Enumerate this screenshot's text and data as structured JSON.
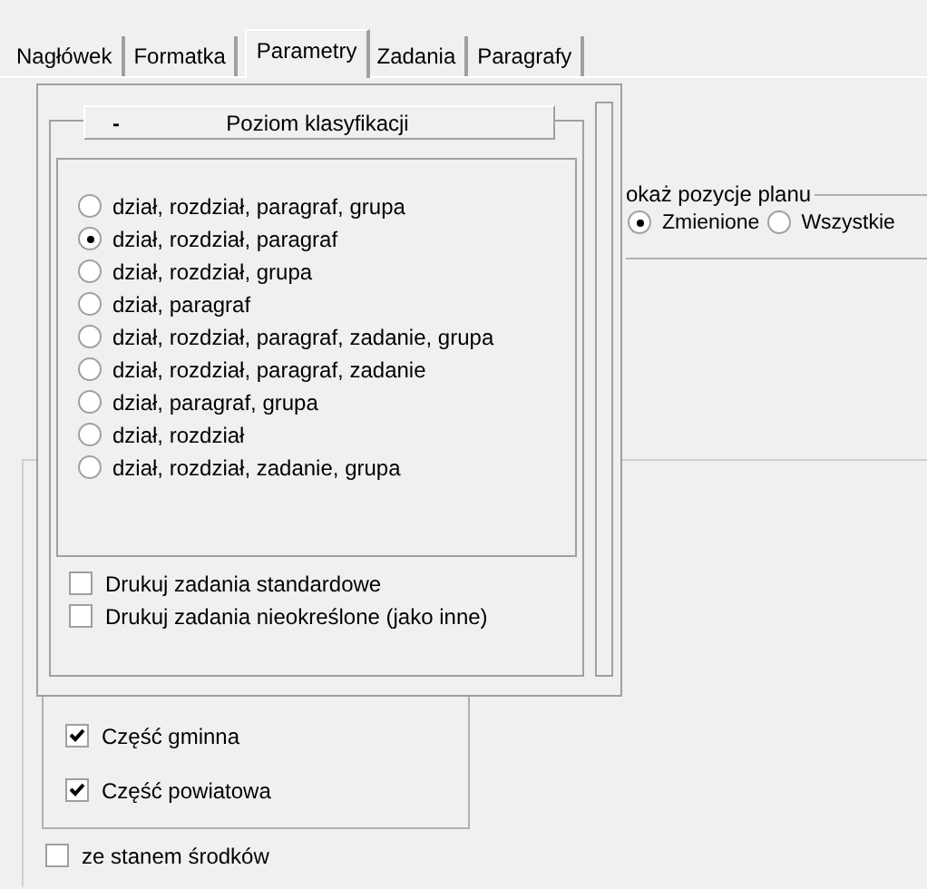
{
  "tabs": [
    {
      "label": "Nagłówek",
      "selected": false
    },
    {
      "label": "Formatka",
      "selected": false
    },
    {
      "label": "Parametry",
      "selected": true
    },
    {
      "label": "Zadania",
      "selected": false
    },
    {
      "label": "Paragrafy",
      "selected": false
    }
  ],
  "plan_group": {
    "title": "okaż pozycje planu",
    "options": [
      {
        "label": "Zmienione",
        "selected": true
      },
      {
        "label": "Wszystkie",
        "selected": false
      }
    ]
  },
  "parts_group": {
    "options": [
      {
        "label": "Część gminna",
        "checked": true
      },
      {
        "label": "Część powiatowa",
        "checked": true
      }
    ]
  },
  "balance_checkbox": {
    "label": "ze stanem środków",
    "checked": false
  },
  "popup": {
    "toggle": "-",
    "title": "Poziom klasyfikacji",
    "levels": [
      {
        "label": "dział, rozdział, paragraf, grupa",
        "selected": false
      },
      {
        "label": "dział, rozdział, paragraf",
        "selected": true
      },
      {
        "label": "dział, rozdział, grupa",
        "selected": false
      },
      {
        "label": "dział, paragraf",
        "selected": false
      },
      {
        "label": "dział, rozdział, paragraf, zadanie, grupa",
        "selected": false
      },
      {
        "label": "dział, rozdział, paragraf, zadanie",
        "selected": false
      },
      {
        "label": "dział, paragraf, grupa",
        "selected": false
      },
      {
        "label": "dział, rozdział",
        "selected": false
      },
      {
        "label": "dział, rozdział, zadanie, grupa",
        "selected": false
      }
    ],
    "options": [
      {
        "label": "Drukuj zadania standardowe",
        "checked": false
      },
      {
        "label": "Drukuj zadania nieokreślone (jako inne)",
        "checked": false
      }
    ]
  }
}
